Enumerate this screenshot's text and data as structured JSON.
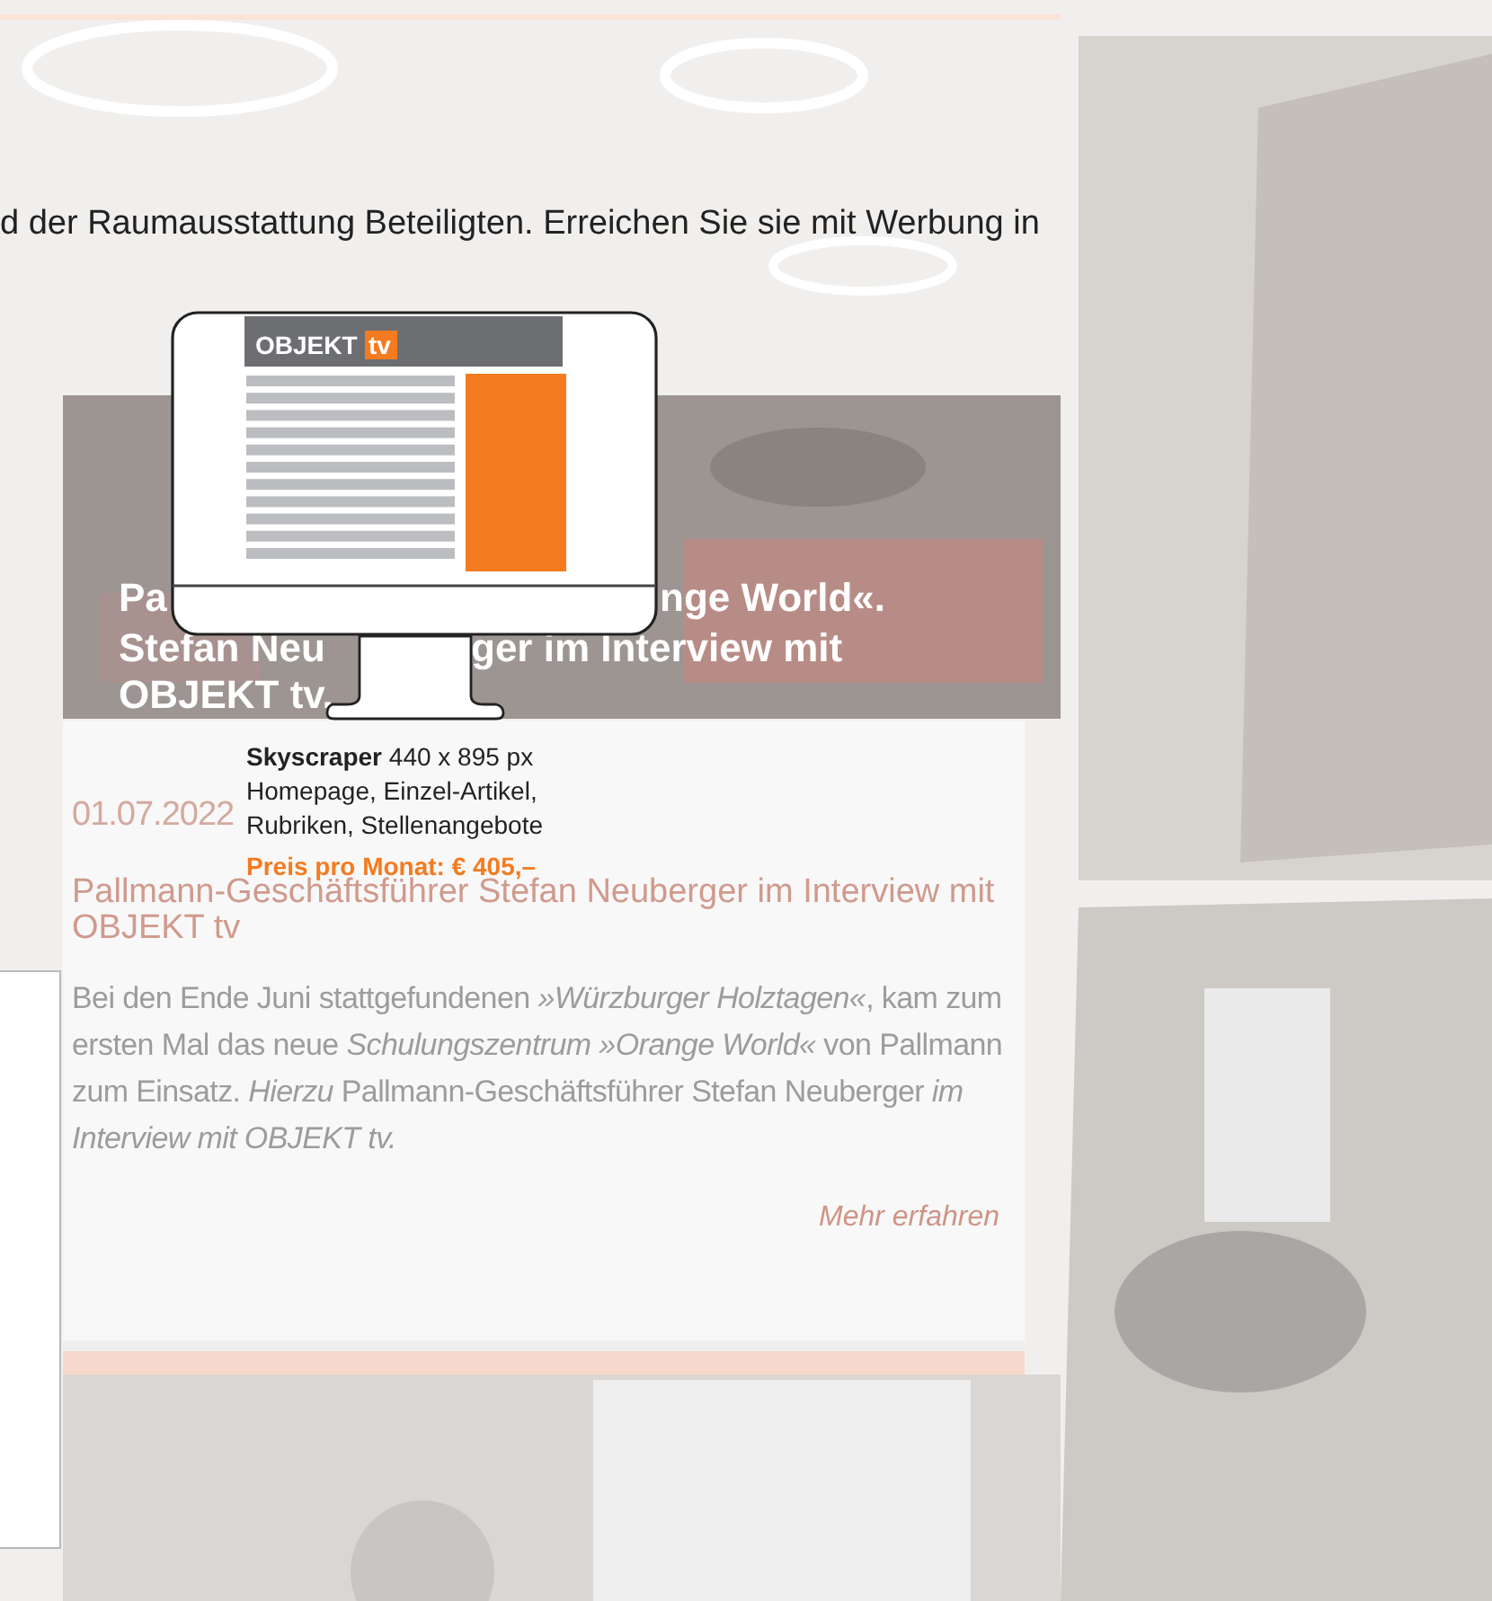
{
  "intro_text": "d der Raumausstattung Beteiligten. Erreichen Sie sie mit Werbung in",
  "article": {
    "headline_parts": [
      "Pa",
      "nge World«.",
      "Stefan Neu",
      "ger im Interview mit",
      "OBJEKT tv."
    ],
    "date": "01.07.2022",
    "title": "Pallmann-Geschäftsführer Stefan Neuberger im Interview mit OBJEKT tv",
    "body": "Bei den Ende Juni stattgefundenen *»Würzburger Holztagen«*, kam zum ersten Mal das neue *Schulungszentrum »Orange World«* von Pallmann zum Einsatz. *Hierzu* Pallmann-Geschäftsführer Stefan Neuberger *im Interview mit OBJEKT tv.*",
    "more_link": "Mehr erfahren"
  },
  "ad_preview": {
    "logo_text": "OBJEKT",
    "logo_badge": "tv",
    "spec": "**Skyscraper** 440 x 895 px",
    "placements": "Homepage, Einzel-Artikel, Rubriken, Stellenangebote",
    "price": "Preis pro Monat: € 405,–"
  }
}
